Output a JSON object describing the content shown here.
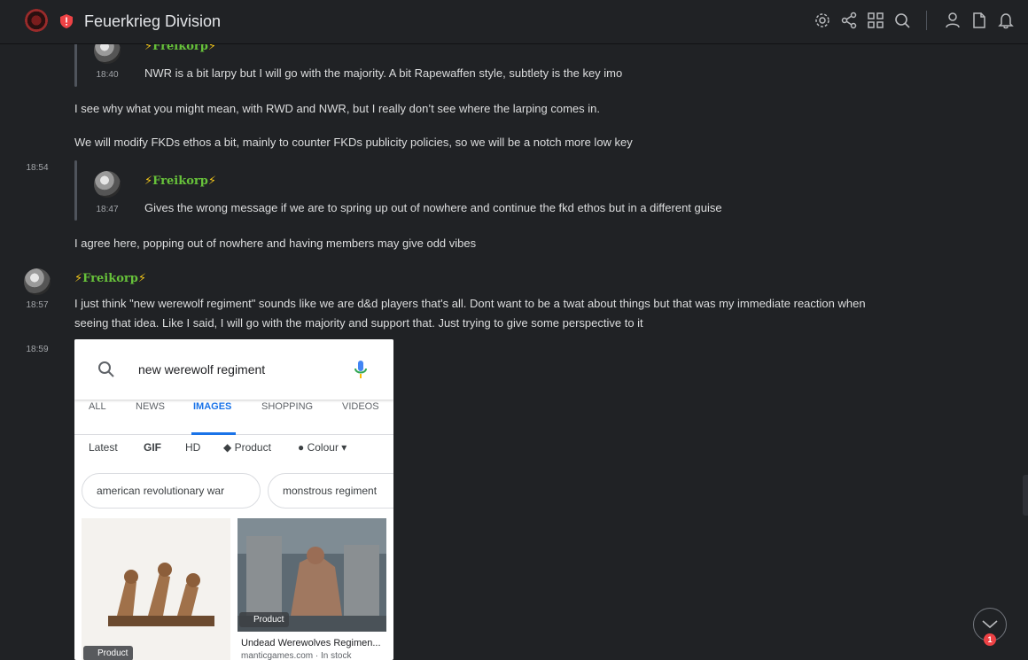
{
  "header": {
    "server_name": "Feuerkrieg Division",
    "server_logo_icon": "server-logo-icon",
    "verified_icon": "shield-alert-icon",
    "icons": [
      "settings-icon",
      "share-icon",
      "apps-grid-icon",
      "search-icon",
      "user-icon",
      "file-icon",
      "bell-icon"
    ]
  },
  "messages": [
    {
      "quote": {
        "author": "Freikorp",
        "time": "18:40",
        "text": "NWR is a bit larpy but I will go with the majority.  A bit Rapewaffen style, subtlety is the key imo"
      },
      "lines": [
        "I see why what you might mean, with RWD and NWR, but I really don’t see where the larping comes in.",
        "We will modify FKDs ethos a bit, mainly to counter FKDs publicity policies, so we will be a notch more low key"
      ]
    },
    {
      "time": "18:54",
      "quote": {
        "author": "Freikorp",
        "time": "18:47",
        "text": "Gives the wrong message if we are to spring up out of nowhere and continue the fkd ethos but in a different guise"
      },
      "lines": [
        "I agree here, popping out of nowhere and having members may give odd vibes"
      ]
    },
    {
      "author": "Freikorp",
      "time": "18:57",
      "text": "I just think \"new werewolf regiment\" sounds like we are d&d players that's all. Dont want to be a twat about things but that was my immediate reaction when seeing that idea. Like I said, I will go with the majority and support that. Just trying to give some perspective to it"
    },
    {
      "time": "18:59",
      "image": {
        "search_query": "new werewolf regiment",
        "tabs": [
          "ALL",
          "NEWS",
          "IMAGES",
          "SHOPPING",
          "VIDEOS"
        ],
        "active_tab": "IMAGES",
        "filters": [
          "Latest",
          "GIF",
          "HD",
          "Product",
          "Colour"
        ],
        "chips": [
          "american revolutionary war",
          "monstrous regiment"
        ],
        "results": [
          {
            "badge": "Product"
          },
          {
            "badge": "Product",
            "title": "Undead Werewolves Regimen...",
            "source": "manticgames.com · In stock"
          }
        ]
      }
    }
  ],
  "jump": {
    "count": "1",
    "icon": "chevron-down-icon"
  },
  "colors": {
    "background": "#202225",
    "username": "#67c23a",
    "bolt": "#f0c419",
    "accent_blue": "#1a73e8"
  }
}
